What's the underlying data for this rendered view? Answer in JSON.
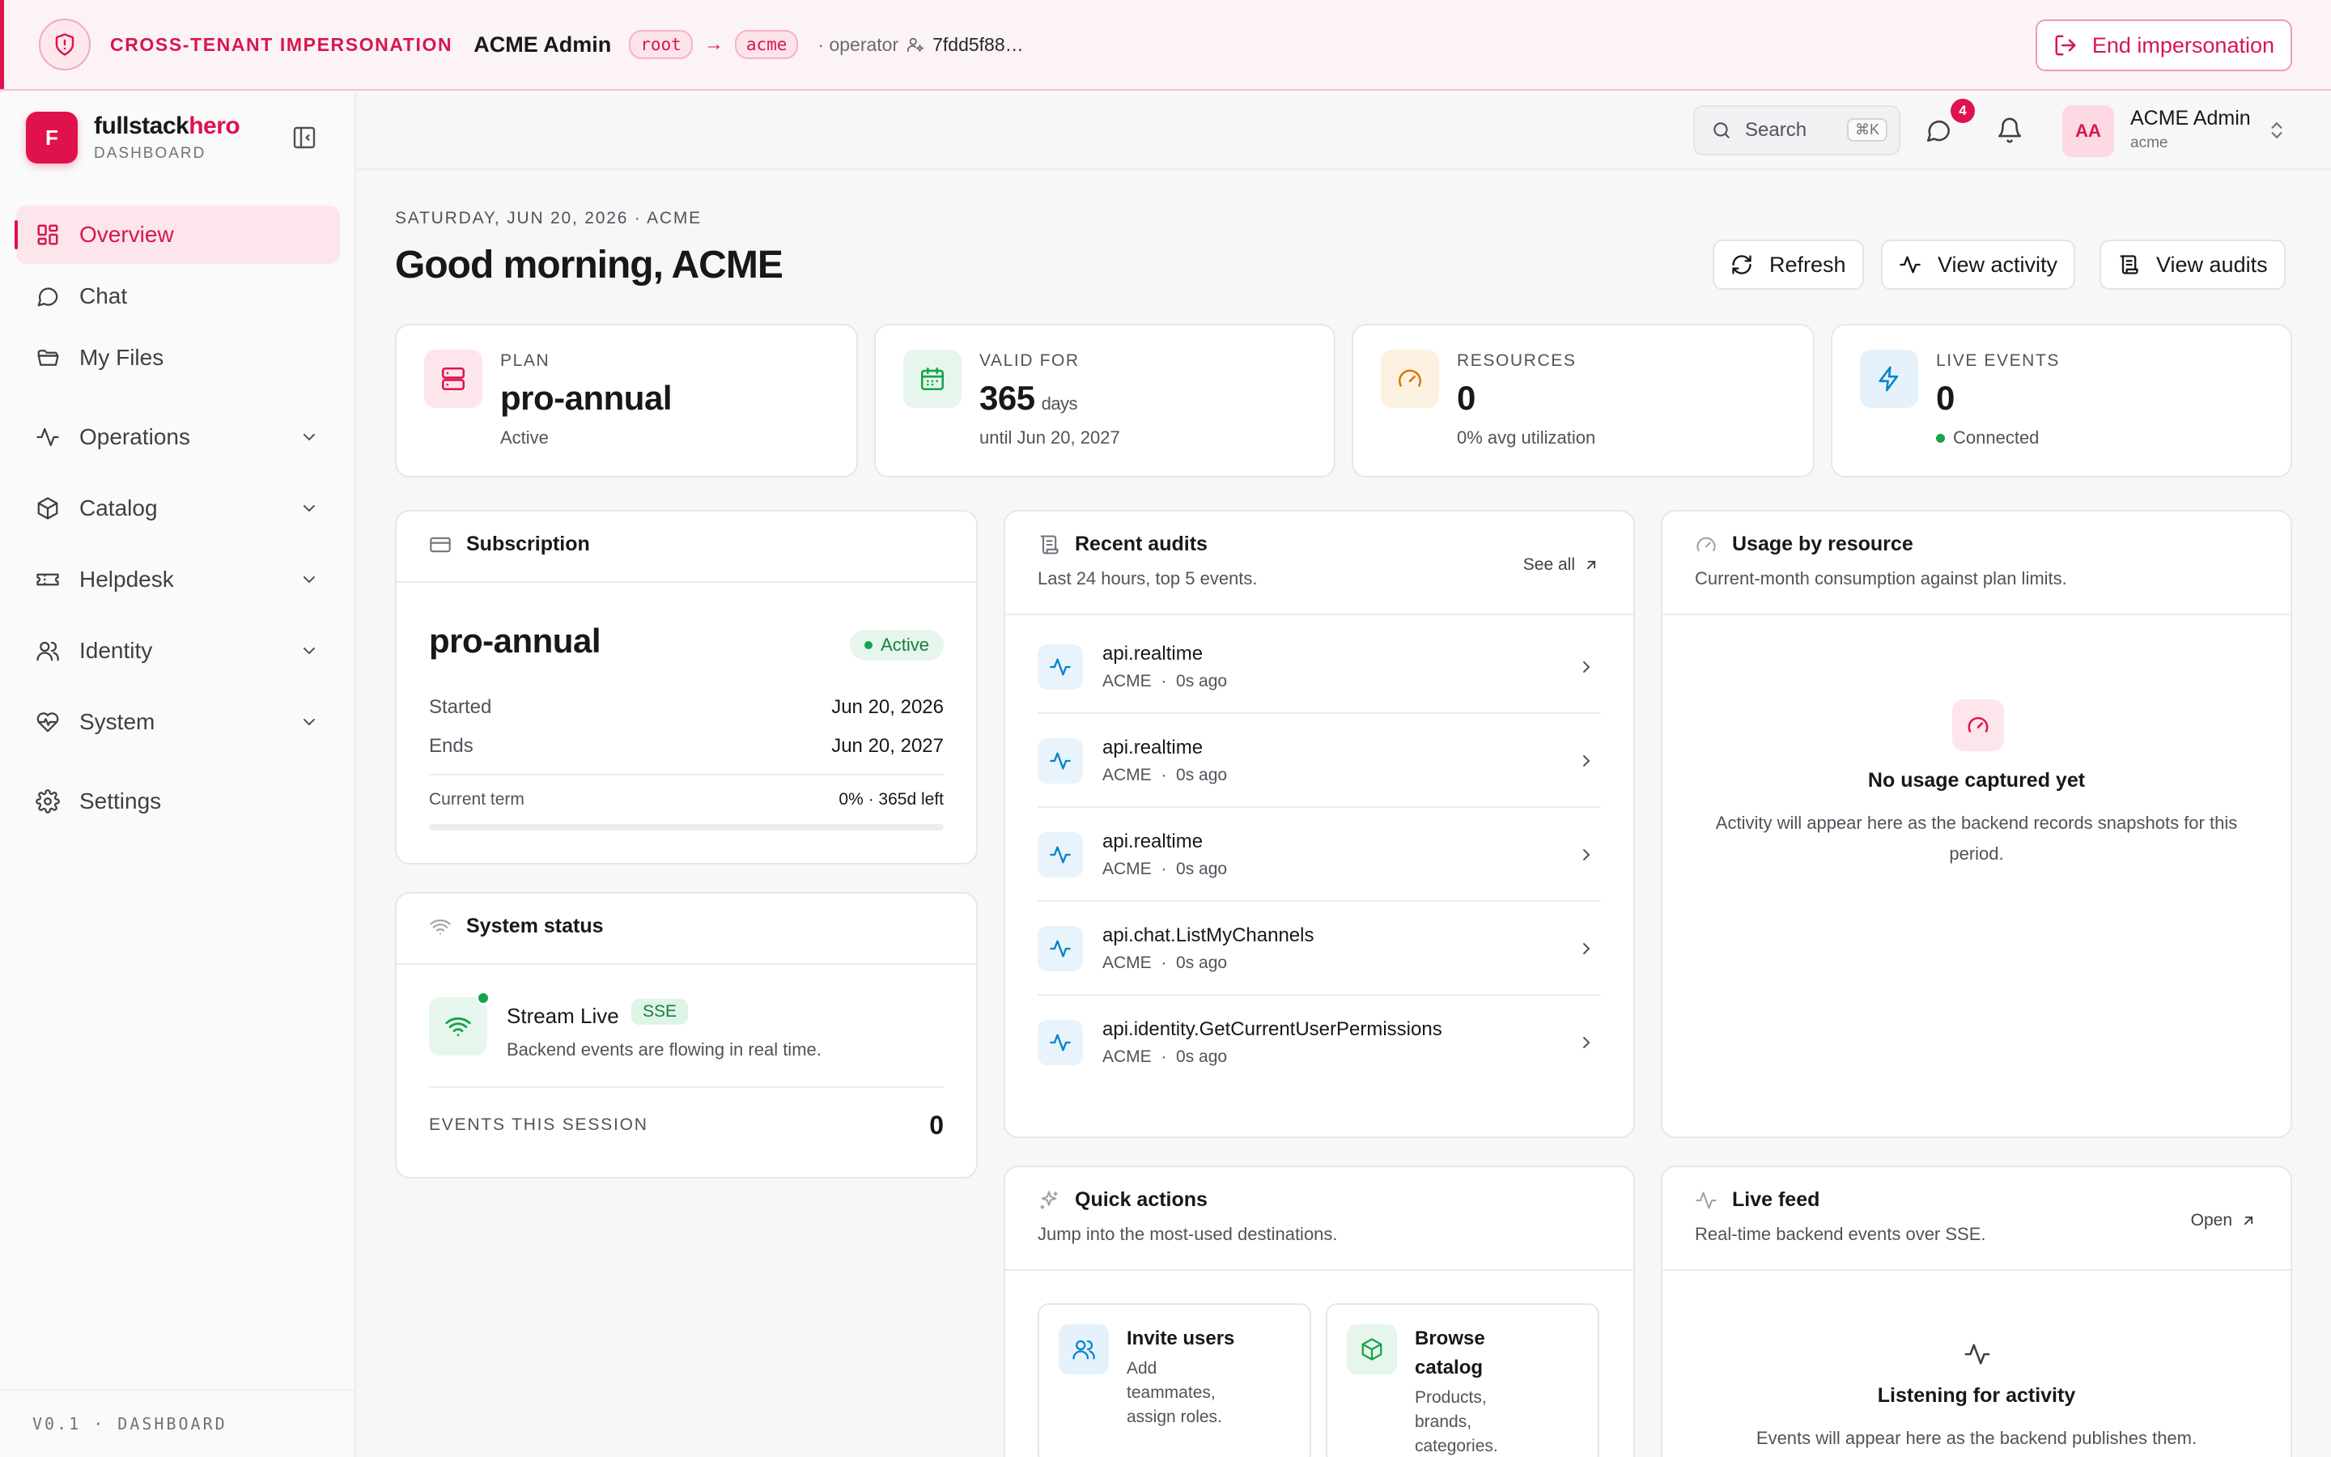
{
  "banner": {
    "label": "CROSS-TENANT IMPERSONATION",
    "user": "ACME Admin",
    "from_tenant": "root",
    "arrow": "→",
    "to_tenant": "acme",
    "operator_label": "· operator",
    "operator_id": "7fdd5f88…",
    "end_label": "End impersonation"
  },
  "brand": {
    "name_a": "fullstack",
    "name_b": "hero",
    "sub": "DASHBOARD",
    "logo_letter": "F"
  },
  "sidebar": {
    "items": [
      {
        "label": "Overview",
        "icon": "grid-icon",
        "active": true
      },
      {
        "label": "Chat",
        "icon": "chat-bubble-icon"
      },
      {
        "label": "My Files",
        "icon": "folder-icon"
      },
      {
        "label": "Operations",
        "icon": "activity-icon",
        "expandable": true
      },
      {
        "label": "Catalog",
        "icon": "package-icon",
        "expandable": true
      },
      {
        "label": "Helpdesk",
        "icon": "ticket-icon",
        "expandable": true
      },
      {
        "label": "Identity",
        "icon": "users-icon",
        "expandable": true
      },
      {
        "label": "System",
        "icon": "heart-pulse-icon",
        "expandable": true
      },
      {
        "label": "Settings",
        "icon": "gear-icon"
      }
    ],
    "footer": "V0.1 · DASHBOARD"
  },
  "topbar": {
    "search_label": "Search",
    "search_kbd": "⌘K",
    "message_badge": "4",
    "avatar_initials": "AA",
    "user_name": "ACME Admin",
    "user_tenant": "acme"
  },
  "header": {
    "eyebrow": "SATURDAY, JUN 20, 2026 · ACME",
    "greeting": "Good morning, ACME",
    "refresh": "Refresh",
    "view_activity": "View activity",
    "view_audits": "View audits"
  },
  "stats": {
    "plan": {
      "label": "PLAN",
      "value": "pro-annual",
      "sub": "Active"
    },
    "valid": {
      "label": "VALID FOR",
      "value": "365",
      "unit": "days",
      "sub": "until Jun 20, 2027"
    },
    "resources": {
      "label": "RESOURCES",
      "value": "0",
      "sub": "0% avg utilization"
    },
    "live": {
      "label": "LIVE EVENTS",
      "value": "0",
      "sub": "Connected"
    }
  },
  "subscription": {
    "title": "Subscription",
    "plan": "pro-annual",
    "status": "Active",
    "started_label": "Started",
    "started_value": "Jun 20, 2026",
    "ends_label": "Ends",
    "ends_value": "Jun 20, 2027",
    "term_label": "Current term",
    "term_value": "0% · 365d left",
    "term_progress": 0
  },
  "system_status": {
    "title": "System status",
    "stream_name": "Stream Live",
    "stream_tag": "SSE",
    "stream_desc": "Backend events are flowing in real time.",
    "events_label": "EVENTS THIS SESSION",
    "events_value": "0"
  },
  "audits": {
    "title": "Recent audits",
    "desc": "Last 24 hours, top 5 events.",
    "see_all": "See all",
    "rows": [
      {
        "name": "api.realtime",
        "tenant": "ACME",
        "dot": "·",
        "time": "0s ago"
      },
      {
        "name": "api.realtime",
        "tenant": "ACME",
        "dot": "·",
        "time": "0s ago"
      },
      {
        "name": "api.realtime",
        "tenant": "ACME",
        "dot": "·",
        "time": "0s ago"
      },
      {
        "name": "api.chat.ListMyChannels",
        "tenant": "ACME",
        "dot": "·",
        "time": "0s ago"
      },
      {
        "name": "api.identity.GetCurrentUserPermissions",
        "tenant": "ACME",
        "dot": "·",
        "time": "0s ago"
      }
    ]
  },
  "usage": {
    "title": "Usage by resource",
    "desc": "Current-month consumption against plan limits.",
    "empty_title": "No usage captured yet",
    "empty_desc": "Activity will appear here as the backend records snapshots for this period."
  },
  "quick_actions": {
    "title": "Quick actions",
    "desc": "Jump into the most-used destinations.",
    "tiles": [
      {
        "title": "Invite users",
        "desc": "Add teammates, assign roles."
      },
      {
        "title": "Browse catalog",
        "desc": "Products, brands, categories."
      }
    ]
  },
  "live_feed": {
    "title": "Live feed",
    "desc": "Real-time backend events over SSE.",
    "open": "Open",
    "empty_title": "Listening for activity",
    "empty_desc": "Events will appear here as the backend publishes them."
  },
  "colors": {
    "accent": "#e0124e",
    "success": "#16a34a",
    "info": "#0284c7",
    "warning": "#d97706"
  }
}
